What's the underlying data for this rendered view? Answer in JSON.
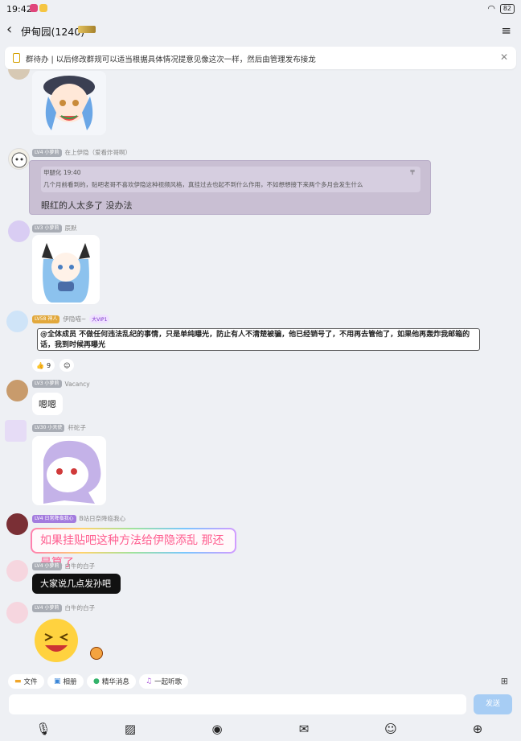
{
  "status_bar": {
    "time": "19:42",
    "battery": "82"
  },
  "header": {
    "title": "伊甸园(1240)",
    "badge_text": ""
  },
  "notice": {
    "text": "群待办 | 以后修改群规可以适当根据具体情况提意见像这次一样，然后由管理发布接龙"
  },
  "messages": [
    {
      "level": "LV4 小萝莉",
      "name": "在上伊隐（爱看炸哥啊）"
    },
    {
      "level": "LV3 小萝莉",
      "name": "辰默"
    },
    {
      "level": "LV58 神人",
      "name": "伊隐喵~",
      "vip": "大VIP1"
    },
    {
      "level": "LV3 小萝莉",
      "name": "Vacancy"
    },
    {
      "level": "LV30 小天使",
      "name": "杆砣子"
    },
    {
      "level": "LV4 日常降临我心",
      "name": "B站日奈降临我心"
    },
    {
      "level": "LV4 小萝莉",
      "name": "白牛的白子"
    },
    {
      "level": "LV4 小萝莉",
      "name": "白牛的白子"
    }
  ],
  "quote": {
    "name": "甲腿化 19:40",
    "text": "几个月前看到的，贴吧老哥不喜欢伊隐这种视频风格，真挂过去也起不到什么作用，不如想想接下来两个多月会发生什么",
    "reply": "眼红的人太多了 没办法"
  },
  "announcement": "@全体成员 不做任何违法乱纪的事情，只是单纯曝光，防止有人不清楚被骗，他已经销号了，不用再去管他了，如果他再轰炸我邮箱的话，我到时候再曝光",
  "reaction": {
    "like_count": "9"
  },
  "text_messages": {
    "ok": "嗯嗯",
    "rainbow": "如果挂贴吧这种方法给伊隐添乱 那还是算了",
    "dark": "大家说几点发孙吧"
  },
  "quick_bar": [
    "文件",
    "相册",
    "精华消息",
    "一起听歌"
  ],
  "input": {
    "placeholder": "",
    "send_label": "发送"
  },
  "colors": {
    "send_button": "#a7cdf4",
    "background": "#eef0f4",
    "quote_bubble": "#c9bfd3"
  }
}
